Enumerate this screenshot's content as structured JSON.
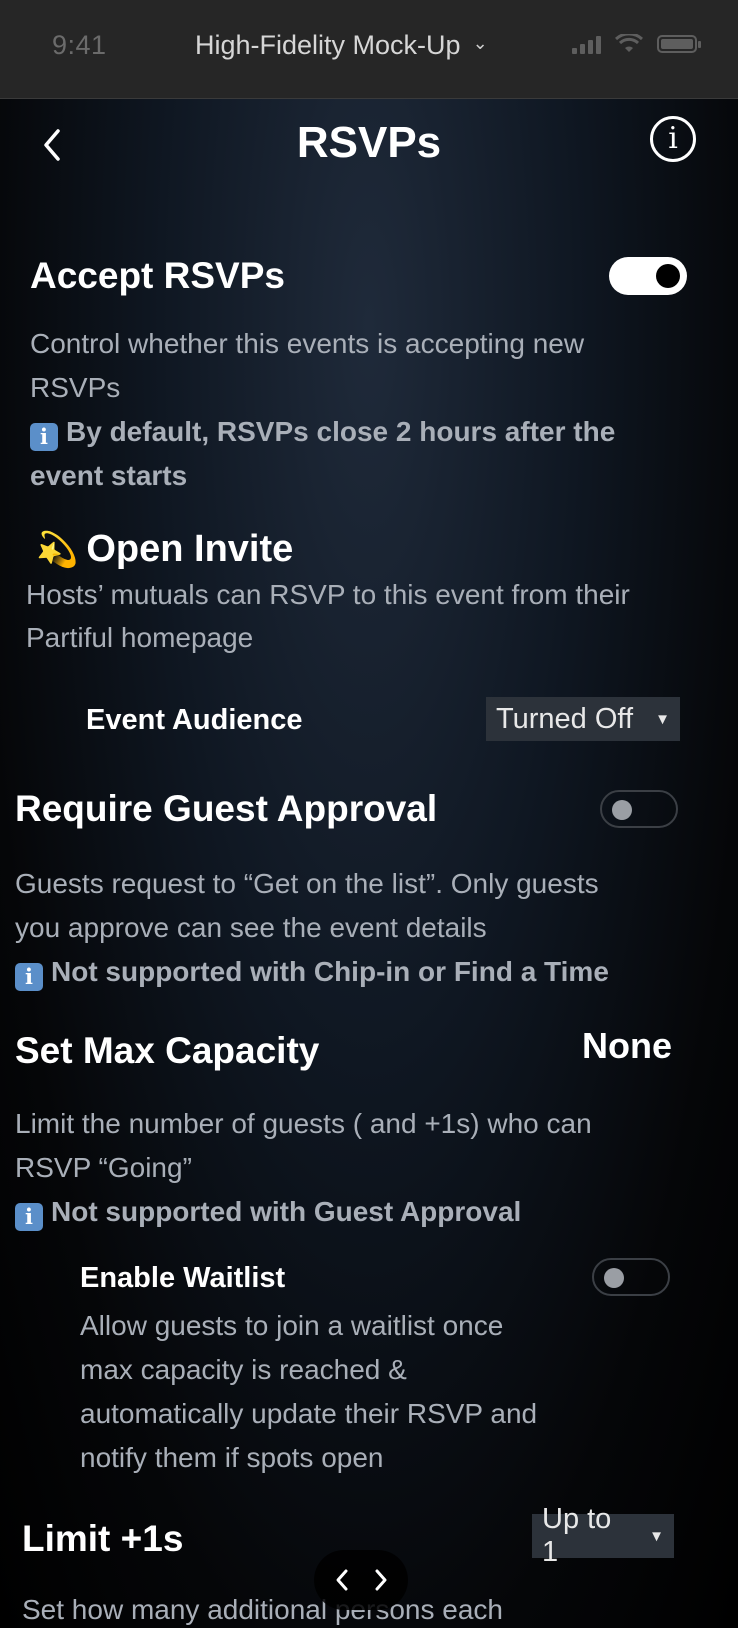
{
  "status_bar": {
    "time": "9:41",
    "title": "High-Fidelity Mock-Up"
  },
  "header": {
    "title": "RSVPs"
  },
  "accept_rsvps": {
    "title": "Accept RSVPs",
    "enabled": true,
    "desc_1": "Control whether this events is accepting new",
    "desc_2": "RSVPs",
    "note_1": "By default, RSVPs close 2 hours after the",
    "note_2": "event starts"
  },
  "open_invite": {
    "emoji": "💫",
    "title": "Open Invite",
    "desc_1": "Hosts’ mutuals can RSVP to this event from their",
    "desc_2": "Partiful homepage",
    "audience_label": "Event Audience",
    "audience_value": "Turned Off"
  },
  "guest_approval": {
    "title": "Require Guest Approval",
    "enabled": false,
    "desc_1": "Guests request to “Get on the list”. Only guests",
    "desc_2": "you approve can see the event details",
    "note": "Not supported with Chip-in or Find a Time"
  },
  "max_capacity": {
    "title": "Set Max Capacity",
    "value": "None",
    "desc_1": "Limit the number of guests ( and +1s) who can",
    "desc_2": "RSVP “Going”",
    "note": "Not supported with Guest Approval"
  },
  "waitlist": {
    "title": "Enable Waitlist",
    "enabled": false,
    "desc_1": "Allow guests to join a waitlist once",
    "desc_2": "max capacity is reached &",
    "desc_3": "automatically update their RSVP and",
    "desc_4": "notify them if spots open"
  },
  "limit_plus_ones": {
    "title": "Limit +1s",
    "value": "Up to 1",
    "desc_1": "Set how many additional persons each"
  },
  "info_badge_glyph": "i",
  "colors": {
    "accent_info": "#5b8fc9",
    "muted_text": "#a9afb8",
    "select_bg": "#2c323a"
  }
}
